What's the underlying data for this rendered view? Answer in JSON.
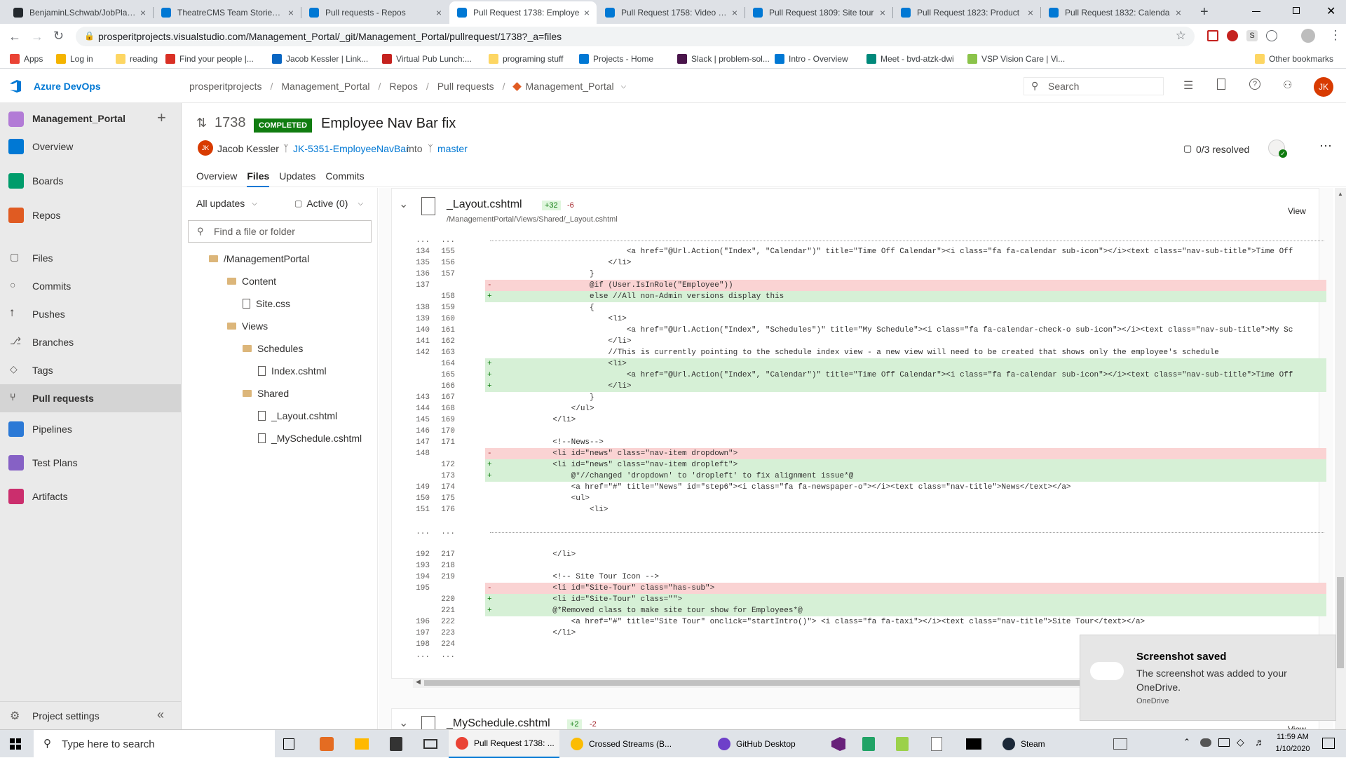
{
  "browser": {
    "tabs": [
      {
        "label": "BenjaminLSchwab/JobPlace",
        "color": "#24292e"
      },
      {
        "label": "TheatreCMS Team Stories B",
        "color": "#0078d4"
      },
      {
        "label": "Pull requests - Repos",
        "color": "#0078d4"
      },
      {
        "label": "Pull Request 1738: Employe",
        "color": "#0078d4",
        "active": true
      },
      {
        "label": "Pull Request 1758: Video Ba",
        "color": "#0078d4"
      },
      {
        "label": "Pull Request 1809: Site tour",
        "color": "#0078d4"
      },
      {
        "label": "Pull Request 1823: Product",
        "color": "#0078d4"
      },
      {
        "label": "Pull Request 1832: Calenda",
        "color": "#0078d4"
      }
    ],
    "url": "prosperitprojects.visualstudio.com/Management_Portal/_git/Management_Portal/pullrequest/1738?_a=files",
    "bookmarks": [
      {
        "label": "Apps",
        "color": "#ea4335"
      },
      {
        "label": "Log in",
        "color": "#f4b400"
      },
      {
        "label": "reading",
        "color": "#fdd663"
      },
      {
        "label": "Find your people |...",
        "color": "#d93025"
      },
      {
        "label": "Jacob Kessler | Link...",
        "color": "#0a66c2"
      },
      {
        "label": "Virtual Pub Lunch:...",
        "color": "#c5221f"
      },
      {
        "label": "programing stuff",
        "color": "#fdd663"
      },
      {
        "label": "Projects - Home",
        "color": "#0078d4"
      },
      {
        "label": "Slack | problem-sol...",
        "color": "#4a154b"
      },
      {
        "label": "Intro - Overview",
        "color": "#0078d4"
      },
      {
        "label": "Meet - bvd-atzk-dwi",
        "color": "#00897b"
      },
      {
        "label": "VSP Vision Care | Vi...",
        "color": "#8bc34a"
      }
    ],
    "other_bookmarks": "Other bookmarks"
  },
  "ado": {
    "brand": "Azure DevOps",
    "breadcrumb": [
      "prosperitprojects",
      "Management_Portal",
      "Repos",
      "Pull requests",
      "Management_Portal"
    ],
    "search_placeholder": "Search",
    "user_initials": "JK"
  },
  "sidebar": {
    "project": "Management_Portal",
    "items": [
      {
        "label": "Overview",
        "color": "#0078d4"
      },
      {
        "label": "Boards",
        "color": "#009c6b"
      },
      {
        "label": "Repos",
        "color": "#e05b22"
      },
      {
        "label": "Pipelines",
        "color": "#2b79d6"
      },
      {
        "label": "Test Plans",
        "color": "#8661c5"
      },
      {
        "label": "Artifacts",
        "color": "#cb2e6d"
      }
    ],
    "sub_items": [
      {
        "label": "Files",
        "icon": "files-icon",
        "glyph": "▢"
      },
      {
        "label": "Commits",
        "icon": "commits-icon",
        "glyph": "○"
      },
      {
        "label": "Pushes",
        "icon": "pushes-icon",
        "glyph": "⭡"
      },
      {
        "label": "Branches",
        "icon": "branches-icon",
        "glyph": "⎇"
      },
      {
        "label": "Tags",
        "icon": "tags-icon",
        "glyph": "◇"
      },
      {
        "label": "Pull requests",
        "icon": "pull-requests-icon",
        "glyph": "⑂"
      }
    ],
    "settings": "Project settings"
  },
  "pr": {
    "id": "1738",
    "status": "COMPLETED",
    "title": "Employee Nav Bar fix",
    "author_initials": "JK",
    "author": "Jacob Kessler",
    "source_branch": "JK-5351-EmployeeNavBar",
    "into": "into",
    "target_branch": "master",
    "resolved": "0/3 resolved",
    "tabs": [
      "Overview",
      "Files",
      "Updates",
      "Commits"
    ]
  },
  "filetree": {
    "filter_updates": "All updates",
    "filter_active": "Active (0)",
    "search_placeholder": "Find a file or folder",
    "nodes": [
      {
        "label": "/ManagementPortal",
        "type": "folder",
        "depth": 0
      },
      {
        "label": "Content",
        "type": "folder",
        "depth": 1
      },
      {
        "label": "Site.css",
        "type": "file",
        "depth": 2
      },
      {
        "label": "Views",
        "type": "folder",
        "depth": 1
      },
      {
        "label": "Schedules",
        "type": "folder",
        "depth": 2
      },
      {
        "label": "Index.cshtml",
        "type": "file",
        "depth": 3
      },
      {
        "label": "Shared",
        "type": "folder",
        "depth": 2
      },
      {
        "label": "_Layout.cshtml",
        "type": "file",
        "depth": 3
      },
      {
        "label": "_MySchedule.cshtml",
        "type": "file",
        "depth": 3
      }
    ]
  },
  "diff": {
    "file_name": "_Layout.cshtml",
    "added": "+32",
    "removed": "-6",
    "path": "/ManagementPortal/Views/Shared/_Layout.cshtml",
    "view_label": "View",
    "lines": [
      {
        "a": "...",
        "b": "...",
        "t": "sep",
        "c": ""
      },
      {
        "a": "134",
        "b": "155",
        "t": "ctx",
        "c": "                            <a href=\"@Url.Action(\"Index\", \"Calendar\")\" title=\"Time Off Calendar\"><i class=\"fa fa-calendar sub-icon\"></i><text class=\"nav-sub-title\">Time Off"
      },
      {
        "a": "135",
        "b": "156",
        "t": "ctx",
        "c": "                        </li>"
      },
      {
        "a": "136",
        "b": "157",
        "t": "ctx",
        "c": "                    }"
      },
      {
        "a": "137",
        "b": "",
        "t": "del",
        "c": "                    @if (User.IsInRole(\"Employee\"))"
      },
      {
        "a": "",
        "b": "158",
        "t": "add",
        "c": "                    else //All non-Admin versions display this"
      },
      {
        "a": "138",
        "b": "159",
        "t": "ctx",
        "c": "                    {"
      },
      {
        "a": "139",
        "b": "160",
        "t": "ctx",
        "c": "                        <li>"
      },
      {
        "a": "140",
        "b": "161",
        "t": "ctx",
        "c": "                            <a href=\"@Url.Action(\"Index\", \"Schedules\")\" title=\"My Schedule\"><i class=\"fa fa-calendar-check-o sub-icon\"></i><text class=\"nav-sub-title\">My Sc"
      },
      {
        "a": "141",
        "b": "162",
        "t": "ctx",
        "c": "                        </li>"
      },
      {
        "a": "142",
        "b": "163",
        "t": "ctx",
        "c": "                        //This is currently pointing to the schedule index view - a new view will need to be created that shows only the employee's schedule"
      },
      {
        "a": "",
        "b": "164",
        "t": "add",
        "c": "                        <li>"
      },
      {
        "a": "",
        "b": "165",
        "t": "add",
        "c": "                            <a href=\"@Url.Action(\"Index\", \"Calendar\")\" title=\"Time Off Calendar\"><i class=\"fa fa-calendar sub-icon\"></i><text class=\"nav-sub-title\">Time Off"
      },
      {
        "a": "",
        "b": "166",
        "t": "add",
        "c": "                        </li>"
      },
      {
        "a": "143",
        "b": "167",
        "t": "ctx",
        "c": "                    }"
      },
      {
        "a": "144",
        "b": "168",
        "t": "ctx",
        "c": "                </ul>"
      },
      {
        "a": "145",
        "b": "169",
        "t": "ctx",
        "c": "            </li>"
      },
      {
        "a": "146",
        "b": "170",
        "t": "ctx",
        "c": ""
      },
      {
        "a": "147",
        "b": "171",
        "t": "ctx",
        "c": "            <!--News-->"
      },
      {
        "a": "148",
        "b": "",
        "t": "del",
        "c": "            <li id=\"news\" class=\"nav-item dropdown\">"
      },
      {
        "a": "",
        "b": "172",
        "t": "add",
        "c": "            <li id=\"news\" class=\"nav-item dropleft\">"
      },
      {
        "a": "",
        "b": "173",
        "t": "add",
        "c": "                @*//changed 'dropdown' to 'dropleft' to fix alignment issue*@"
      },
      {
        "a": "149",
        "b": "174",
        "t": "ctx",
        "c": "                <a href=\"#\" title=\"News\" id=\"step6\"><i class=\"fa fa-newspaper-o\"></i><text class=\"nav-title\">News</text></a>"
      },
      {
        "a": "150",
        "b": "175",
        "t": "ctx",
        "c": "                <ul>"
      },
      {
        "a": "151",
        "b": "176",
        "t": "ctx",
        "c": "                    <li>"
      },
      {
        "a": "",
        "b": "",
        "t": "blank",
        "c": ""
      },
      {
        "a": "...",
        "b": "...",
        "t": "sep",
        "c": ""
      },
      {
        "a": "",
        "b": "",
        "t": "blank",
        "c": ""
      },
      {
        "a": "192",
        "b": "217",
        "t": "ctx",
        "c": "            </li>"
      },
      {
        "a": "193",
        "b": "218",
        "t": "ctx",
        "c": ""
      },
      {
        "a": "194",
        "b": "219",
        "t": "ctx",
        "c": "            <!-- Site Tour Icon -->"
      },
      {
        "a": "195",
        "b": "",
        "t": "del",
        "c": "            <li id=\"Site-Tour\" class=\"has-sub\">"
      },
      {
        "a": "",
        "b": "220",
        "t": "add",
        "c": "            <li id=\"Site-Tour\" class=\"\">"
      },
      {
        "a": "",
        "b": "221",
        "t": "add",
        "c": "            @*Removed class to make site tour show for Employees*@"
      },
      {
        "a": "196",
        "b": "222",
        "t": "ctx",
        "c": "                <a href=\"#\" title=\"Site Tour\" onclick=\"startIntro()\"> <i class=\"fa fa-taxi\"></i><text class=\"nav-title\">Site Tour</text></a>"
      },
      {
        "a": "197",
        "b": "223",
        "t": "ctx",
        "c": "            </li>"
      },
      {
        "a": "198",
        "b": "224",
        "t": "ctx",
        "c": ""
      },
      {
        "a": "...",
        "b": "...",
        "t": "end",
        "c": ""
      }
    ],
    "next_file_name": "_MySchedule.cshtml",
    "next_added": "+2",
    "next_removed": "-2",
    "next_view_label": "View"
  },
  "toast": {
    "title": "Screenshot saved",
    "body": "The screenshot was added to your OneDrive.",
    "source": "OneDrive"
  },
  "taskbar": {
    "search_placeholder": "Type here to search",
    "items": [
      {
        "label": "Pull Request 1738: ...",
        "color": "#ea4335"
      },
      {
        "label": "Crossed Streams (B...",
        "color": "#fbbc04"
      },
      {
        "label": "GitHub Desktop",
        "color": "#6e40c9"
      },
      {
        "label": "Steam",
        "color": "#1b2838"
      }
    ],
    "time": "11:59 AM",
    "date": "1/10/2020"
  }
}
